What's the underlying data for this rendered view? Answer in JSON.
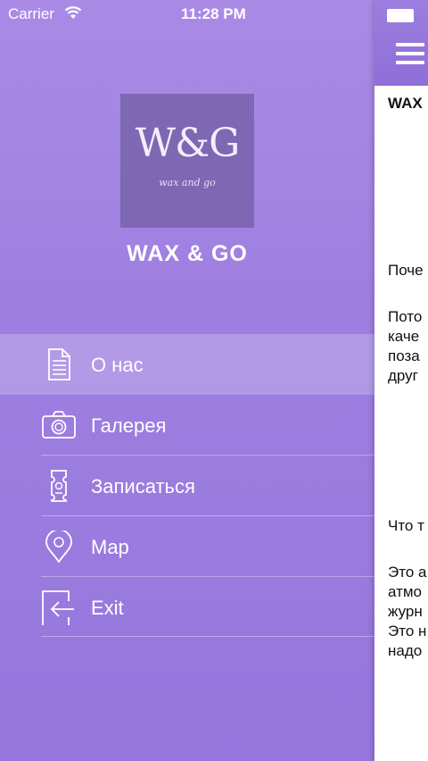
{
  "status_bar": {
    "carrier": "Carrier",
    "time": "11:28 PM"
  },
  "logo": {
    "mark": "W&G",
    "tagline": "wax and go"
  },
  "brand_title": "WAX & GO",
  "menu": {
    "items": [
      {
        "label": "О нас",
        "icon": "document-icon",
        "active": true
      },
      {
        "label": "Галерея",
        "icon": "camera-icon",
        "active": false
      },
      {
        "label": "Записаться",
        "icon": "ticket-icon",
        "active": false
      },
      {
        "label": "Map",
        "icon": "map-pin-icon",
        "active": false
      },
      {
        "label": "Exit",
        "icon": "exit-icon",
        "active": false
      }
    ]
  },
  "content": {
    "title": "WAX",
    "lines": [
      "Поче",
      "Пото",
      "каче",
      "поза",
      "друг",
      "Что т",
      "Это а",
      "атмо",
      "журн",
      "Это н",
      "надо"
    ]
  },
  "colors": {
    "menu_bg": "#9d7ee0",
    "accent": "#8f6fd8",
    "text": "#ffffff"
  }
}
